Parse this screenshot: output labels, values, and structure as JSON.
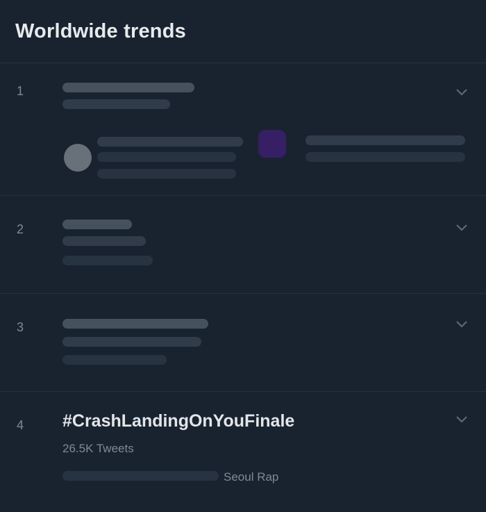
{
  "header": {
    "title": "Worldwide trends"
  },
  "trends": [
    {
      "rank": "1"
    },
    {
      "rank": "2"
    },
    {
      "rank": "3"
    },
    {
      "rank": "4",
      "title": "#CrashLandingOnYouFinale",
      "tweet_count": "26.5K Tweets",
      "related_suffix": "Seoul Rap"
    }
  ],
  "icons": {
    "more": "chevron-down-icon"
  },
  "colors": {
    "background": "#192330",
    "divider": "#243140",
    "secondary_text": "#7c8a97",
    "promo_purple": "#3a1f6a"
  }
}
